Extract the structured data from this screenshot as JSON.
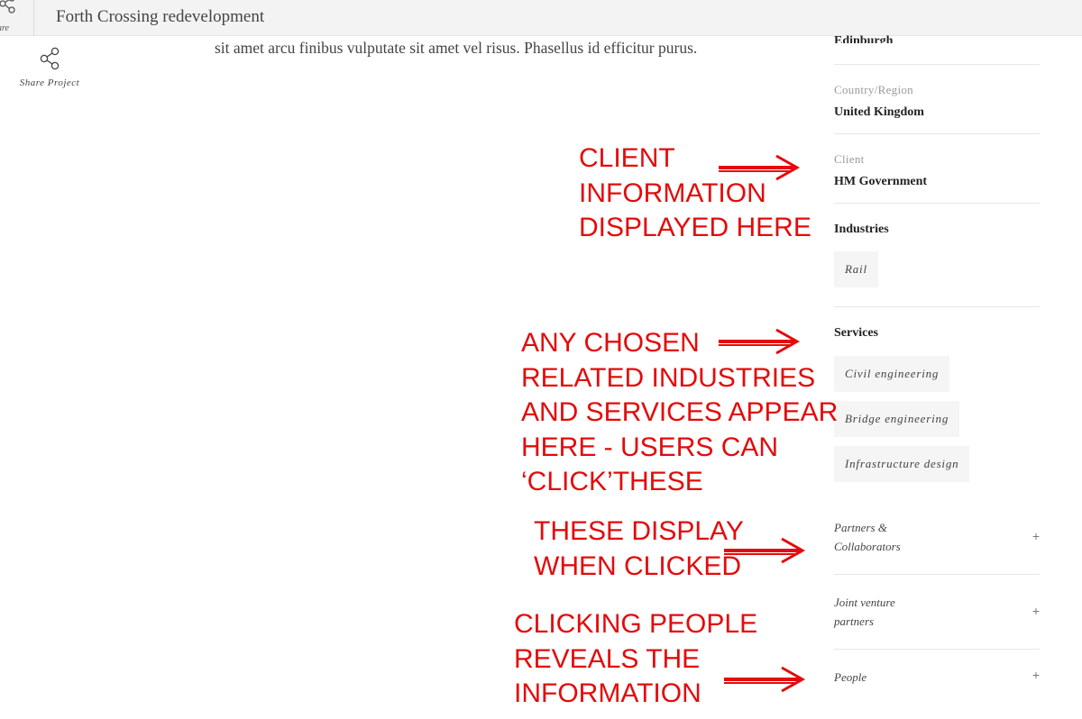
{
  "header": {
    "share_label": "hare",
    "title": "Forth Crossing redevelopment"
  },
  "share_project": {
    "label": "Share Project"
  },
  "body": {
    "text": "sit amet arcu finibus vulputate sit amet vel risus. Phasellus id efficitur purus."
  },
  "sidebar": {
    "city_value": "Edinburgh",
    "country": {
      "label": "Country/Region",
      "value": "United Kingdom"
    },
    "client": {
      "label": "Client",
      "value": "HM Government"
    },
    "industries": {
      "heading": "Industries",
      "tags": [
        "Rail"
      ]
    },
    "services": {
      "heading": "Services",
      "tags": [
        "Civil engineering",
        "Bridge engineering",
        "Infrastructure design"
      ]
    },
    "accordions": [
      {
        "label_line1": "Partners &",
        "label_line2": "Collaborators",
        "icon": "plus-icon",
        "sign": "+"
      },
      {
        "label_line1": "Joint venture",
        "label_line2": "partners",
        "icon": "plus-icon",
        "sign": "+"
      },
      {
        "label_line1": "People",
        "label_line2": "",
        "icon": "plus-icon",
        "sign": "+"
      }
    ]
  },
  "annotations": [
    {
      "lines": [
        "CLIENT",
        "INFORMATION",
        "DISPLAYED HERE"
      ]
    },
    {
      "lines": [
        "ANY CHOSEN",
        "RELATED INDUSTRIES",
        "AND SERVICES APPEAR",
        "HERE - USERS CAN",
        "‘CLICK’THESE"
      ]
    },
    {
      "lines": [
        "THESE DISPLAY",
        "WHEN CLICKED"
      ]
    },
    {
      "lines": [
        "CLICKING PEOPLE",
        "REVEALS THE",
        "INFORMATION"
      ]
    }
  ],
  "colors": {
    "annotation_red": "#e30b0b",
    "tag_bg": "#f5f5f5",
    "topbar_bg": "#f3f3f3"
  }
}
